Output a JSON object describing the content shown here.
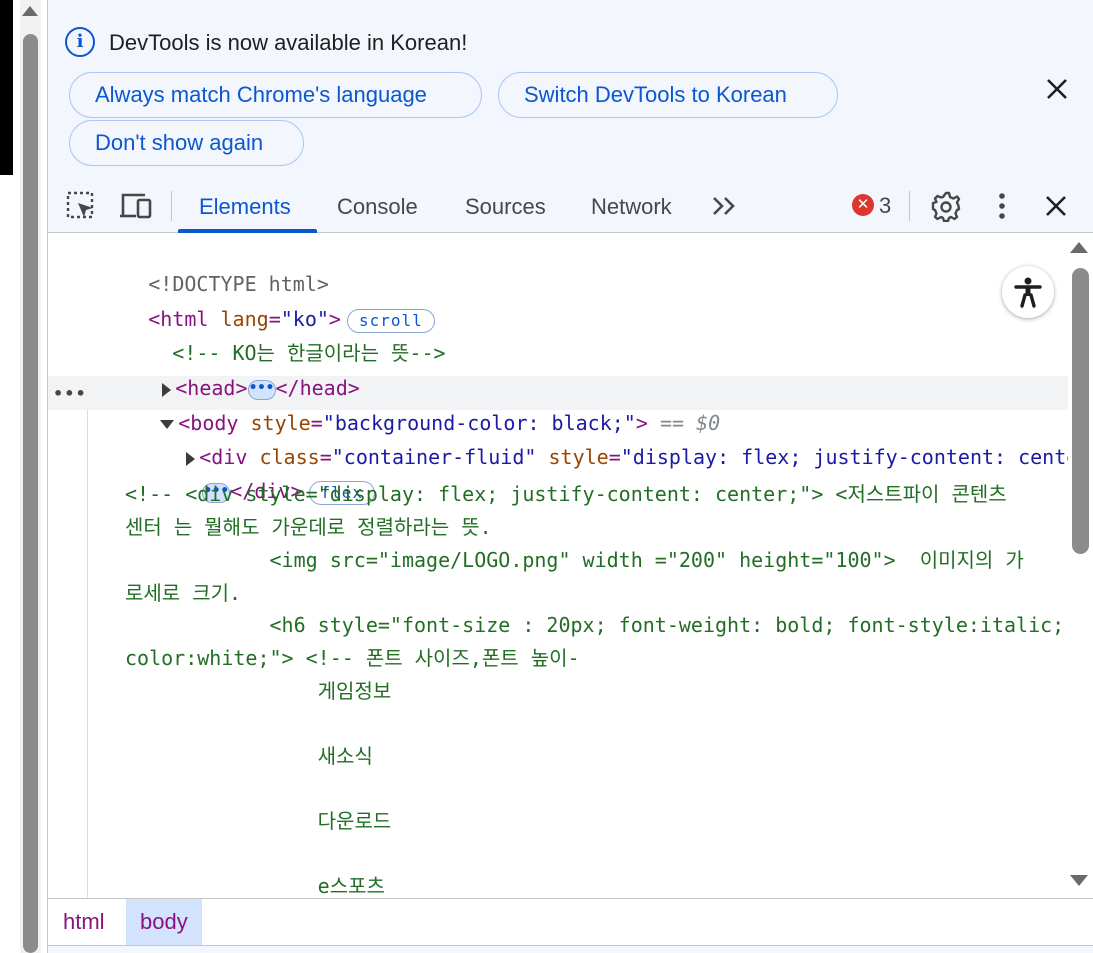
{
  "infobar": {
    "message": "DevTools is now available in Korean!",
    "buttons": {
      "always_match": "Always match Chrome's language",
      "switch": "Switch DevTools to Korean",
      "dont_show": "Don't show again"
    }
  },
  "toolbar": {
    "tabs": [
      "Elements",
      "Console",
      "Sources",
      "Network"
    ],
    "active_tab": "Elements",
    "error_count": "3"
  },
  "tree": {
    "doctype": "<!DOCTYPE html>",
    "html_open": "<html",
    "html_attr": "lang",
    "html_val": "\"ko\"",
    "html_close": ">",
    "scroll_badge": "scroll",
    "comment_ko": "<!-- KO는 한글이라는 뜻-->",
    "head_open": "<head>",
    "head_close": "</head>",
    "body_open": "<body",
    "body_attr": "style",
    "body_val": "\"background-color: black;\"",
    "body_close": ">",
    "eq0": "== $0",
    "div_open": "<div",
    "div_attr1": "class",
    "div_val1": "\"container-fluid\"",
    "div_attr2": "style",
    "div_val2": "\"display: flex; justify-content: center; \"",
    "div_close_bracket": ">",
    "div_close": "</div>",
    "flex_badge": "flex",
    "comment_lines": [
      "<!-- <div style=\"display: flex; justify-content: center;\"> <저스트파이 콘텐츠",
      "센터 는 뭘해도 가운데로 정렬하라는 뜻.",
      "            <img src=\"image/LOGO.png\" width =\"200\" height=\"100\">  이미지의 가",
      "로세로 크기.",
      "            <h6 style=\"font-size : 20px; font-weight: bold; font-style:italic;",
      "color:white;\"> <!-- 폰트 사이즈,폰트 높이-",
      "                게임정보",
      "",
      "                새소식",
      "",
      "                다운로드",
      "",
      "                e스포츠"
    ]
  },
  "breadcrumb": [
    "html",
    "body"
  ],
  "colors": {
    "accent": "#0b57d0",
    "tag": "#881280",
    "attr": "#994500",
    "value": "#1a1aa6",
    "comment": "#236e25",
    "error": "#dc362e"
  },
  "icons": {
    "info": "info-icon",
    "close": "close-icon",
    "inspect": "inspect-element-icon",
    "device": "device-toolbar-icon",
    "settings": "gear-icon",
    "menu": "kebab-menu-icon",
    "accessibility": "accessibility-icon"
  }
}
